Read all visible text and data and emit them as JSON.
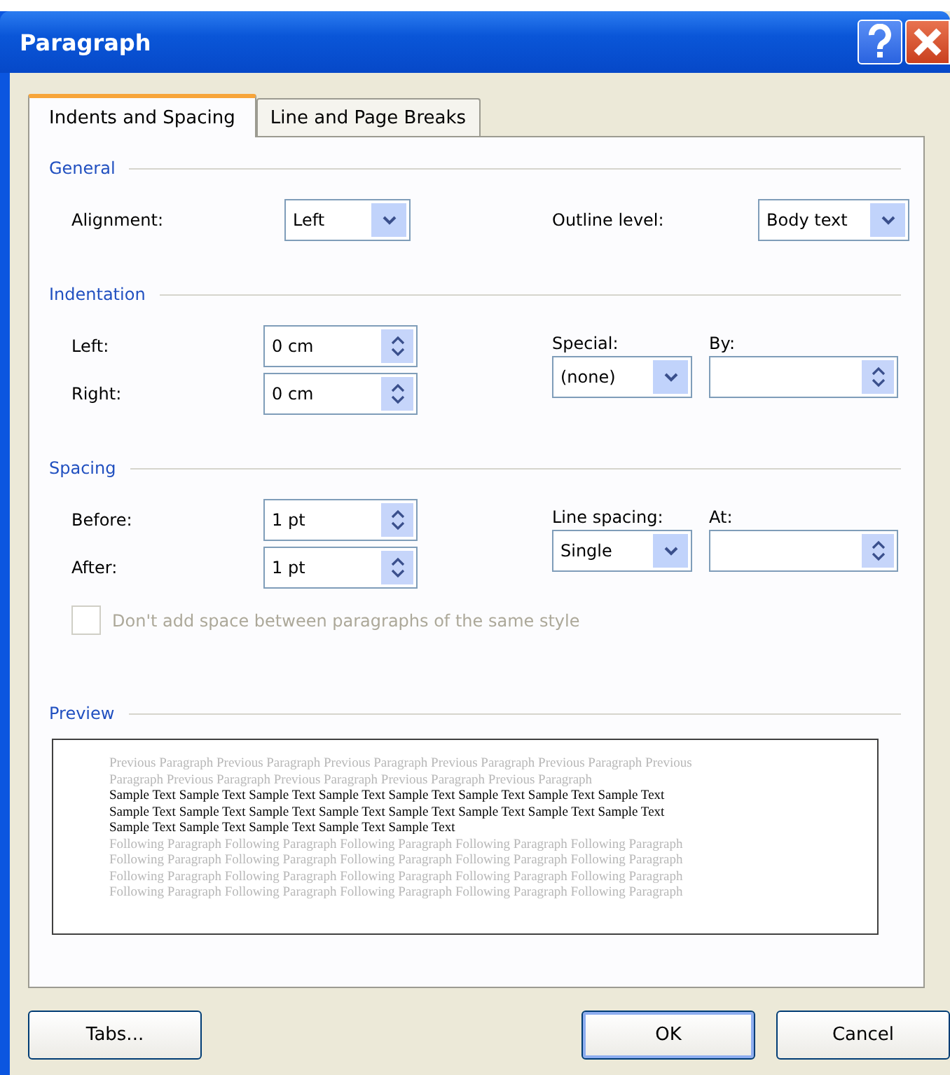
{
  "window": {
    "title": "Paragraph"
  },
  "tabs": [
    {
      "label": "Indents and Spacing",
      "selected": true
    },
    {
      "label": "Line and Page Breaks",
      "selected": false
    }
  ],
  "general": {
    "title": "General",
    "alignment": {
      "label": "Alignment:",
      "value": "Left"
    },
    "outline_level": {
      "label": "Outline level:",
      "value": "Body text"
    }
  },
  "indentation": {
    "title": "Indentation",
    "left": {
      "label": "Left:",
      "value": "0 cm"
    },
    "right": {
      "label": "Right:",
      "value": "0 cm"
    },
    "special": {
      "label": "Special:",
      "value": "(none)"
    },
    "by": {
      "label": "By:"
    }
  },
  "spacing": {
    "title": "Spacing",
    "before": {
      "label": "Before:",
      "value": "1 pt"
    },
    "after": {
      "label": "After:",
      "value": "1 pt"
    },
    "line_spacing": {
      "label": "Line spacing:",
      "value": "Single"
    },
    "at": {
      "label": "At:"
    }
  },
  "no_space_checkbox": {
    "label": "Don't add space between paragraphs of the same style",
    "checked": false,
    "disabled": true
  },
  "preview": {
    "title": "Preview",
    "previous_lines": [
      "Previous Paragraph Previous Paragraph Previous Paragraph Previous Paragraph Previous Paragraph Previous",
      "Paragraph Previous Paragraph Previous Paragraph Previous Paragraph Previous Paragraph"
    ],
    "sample_lines": [
      "Sample Text Sample Text Sample Text Sample Text Sample Text Sample Text Sample Text Sample Text",
      "Sample Text Sample Text Sample Text Sample Text Sample Text Sample Text Sample Text Sample Text",
      "Sample Text Sample Text Sample Text Sample Text Sample Text"
    ],
    "following_lines": [
      "Following Paragraph Following Paragraph Following Paragraph Following Paragraph Following Paragraph",
      "Following Paragraph Following Paragraph Following Paragraph Following Paragraph Following Paragraph",
      "Following Paragraph Following Paragraph Following Paragraph Following Paragraph Following Paragraph",
      "Following Paragraph Following Paragraph Following Paragraph Following Paragraph Following Paragraph"
    ]
  },
  "buttons": [
    {
      "label": "Tabs...",
      "default": false
    },
    {
      "label": "OK",
      "default": true
    },
    {
      "label": "Cancel",
      "default": false
    }
  ]
}
